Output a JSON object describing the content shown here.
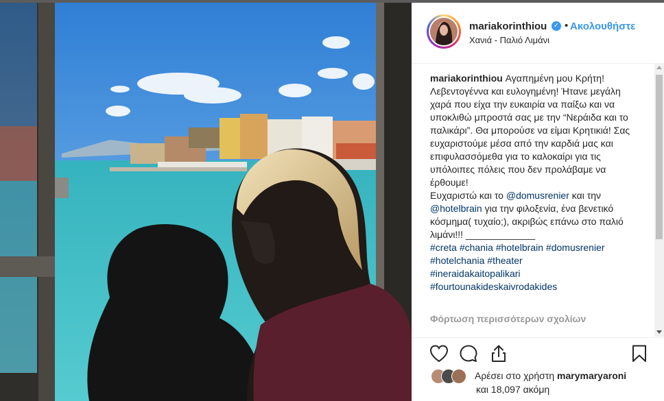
{
  "post": {
    "username": "mariakorinthiou",
    "dot": "•",
    "follow_label": "Ακολουθήστε",
    "location": "Χανιά - Παλιό Λιμάνι",
    "caption_user": "mariakorinthiou",
    "caption_p1": " Αγαπημένη μου Κρήτη! Λεβεντογέννα και ευλογημένη! Ήτανε μεγάλη χαρά που είχα την ευκαιρία να παίξω και να υποκλιθώ μπροστά σας με την “Νεράιδα και το παλικάρι”. Θα μπορούσε να είμαι Κρητικιά! Σας ευχαριστούμε μέσα από την καρδιά μας και επιφυλασσόμεθα για το καλοκαίρι για τις υπόλοιπες πόλεις που δεν προλάβαμε να έρθουμε!",
    "caption_p2a": "Ευχαριστώ και το ",
    "mention1": "@domusrenier",
    "caption_p2b": " και την ",
    "mention2": "@hotelbrain",
    "caption_p2c": " για την φιλοξενία, ένα βενετικό κόσμημα( τυχαίο;), ακριβώς επάνω στο παλιό λιμάνι!!! _____________",
    "hashtags": [
      "#creta",
      "#chania",
      "#hotelbrain",
      "#domusrenier",
      "#hotelchania",
      "#theater",
      "#ineraidakaitopalikari",
      "#fourtounakideskaivrodakides"
    ],
    "load_more": "Φόρτωση περισσότερων σχολίων",
    "likes_prefix": "Αρέσει στο χρήστη ",
    "likes_user": "marymaryaroni",
    "likes_more": "και 18,097 ακόμη"
  },
  "icons": [
    "verified-badge-icon",
    "heart-icon",
    "comment-icon",
    "share-icon",
    "bookmark-icon"
  ],
  "colors": {
    "accent": "#3897f0",
    "link": "#003569",
    "text": "#262626",
    "muted": "#999999",
    "sea": "#3bbdc4",
    "sky": "#3e8fdc"
  }
}
